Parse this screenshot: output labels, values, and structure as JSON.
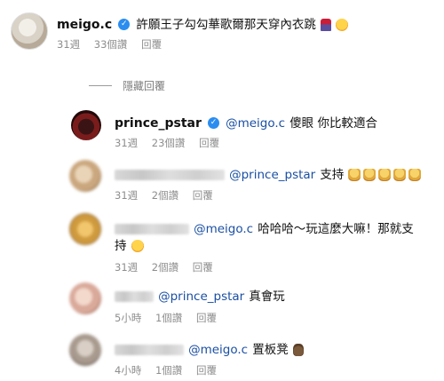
{
  "comments": [
    {
      "username": "meigo.c",
      "verified": true,
      "text": "許願王子勾勾華歌爾那天穿內衣跳",
      "time": "31週",
      "likes": "33個讚",
      "reply": "回覆"
    }
  ],
  "hide_replies": "隱藏回覆",
  "replies": [
    {
      "username": "prince_pstar",
      "verified": true,
      "mention": "@meigo.c",
      "text": "傻眼 你比較適合",
      "time": "31週",
      "likes": "23個讚",
      "reply": "回覆"
    },
    {
      "username_blurred": true,
      "mention": "@prince_pstar",
      "text": "支持",
      "time": "31週",
      "likes": "2個讚",
      "reply": "回覆"
    },
    {
      "username_blurred": true,
      "mention": "@meigo.c",
      "text": "哈哈哈～玩這麼大嘛！那就支持",
      "text_line1": "哈哈哈～玩這麼大嘛！那就支",
      "text_line2": "持",
      "time": "31週",
      "likes": "2個讚",
      "reply": "回覆"
    },
    {
      "username_blurred": true,
      "mention": "@prince_pstar",
      "text": "真會玩",
      "time": "5小時",
      "likes": "1個讚",
      "reply": "回覆"
    },
    {
      "username_blurred": true,
      "mention": "@meigo.c",
      "text": "置板凳",
      "time": "4小時",
      "likes": "1個讚",
      "reply": "回覆"
    }
  ],
  "icons": {
    "verified": "verified-badge-icon",
    "like": "heart-outline-icon"
  },
  "colors": {
    "mention": "#1a4fa3",
    "verified": "#2b8df0",
    "meta": "#8e8e8e"
  }
}
